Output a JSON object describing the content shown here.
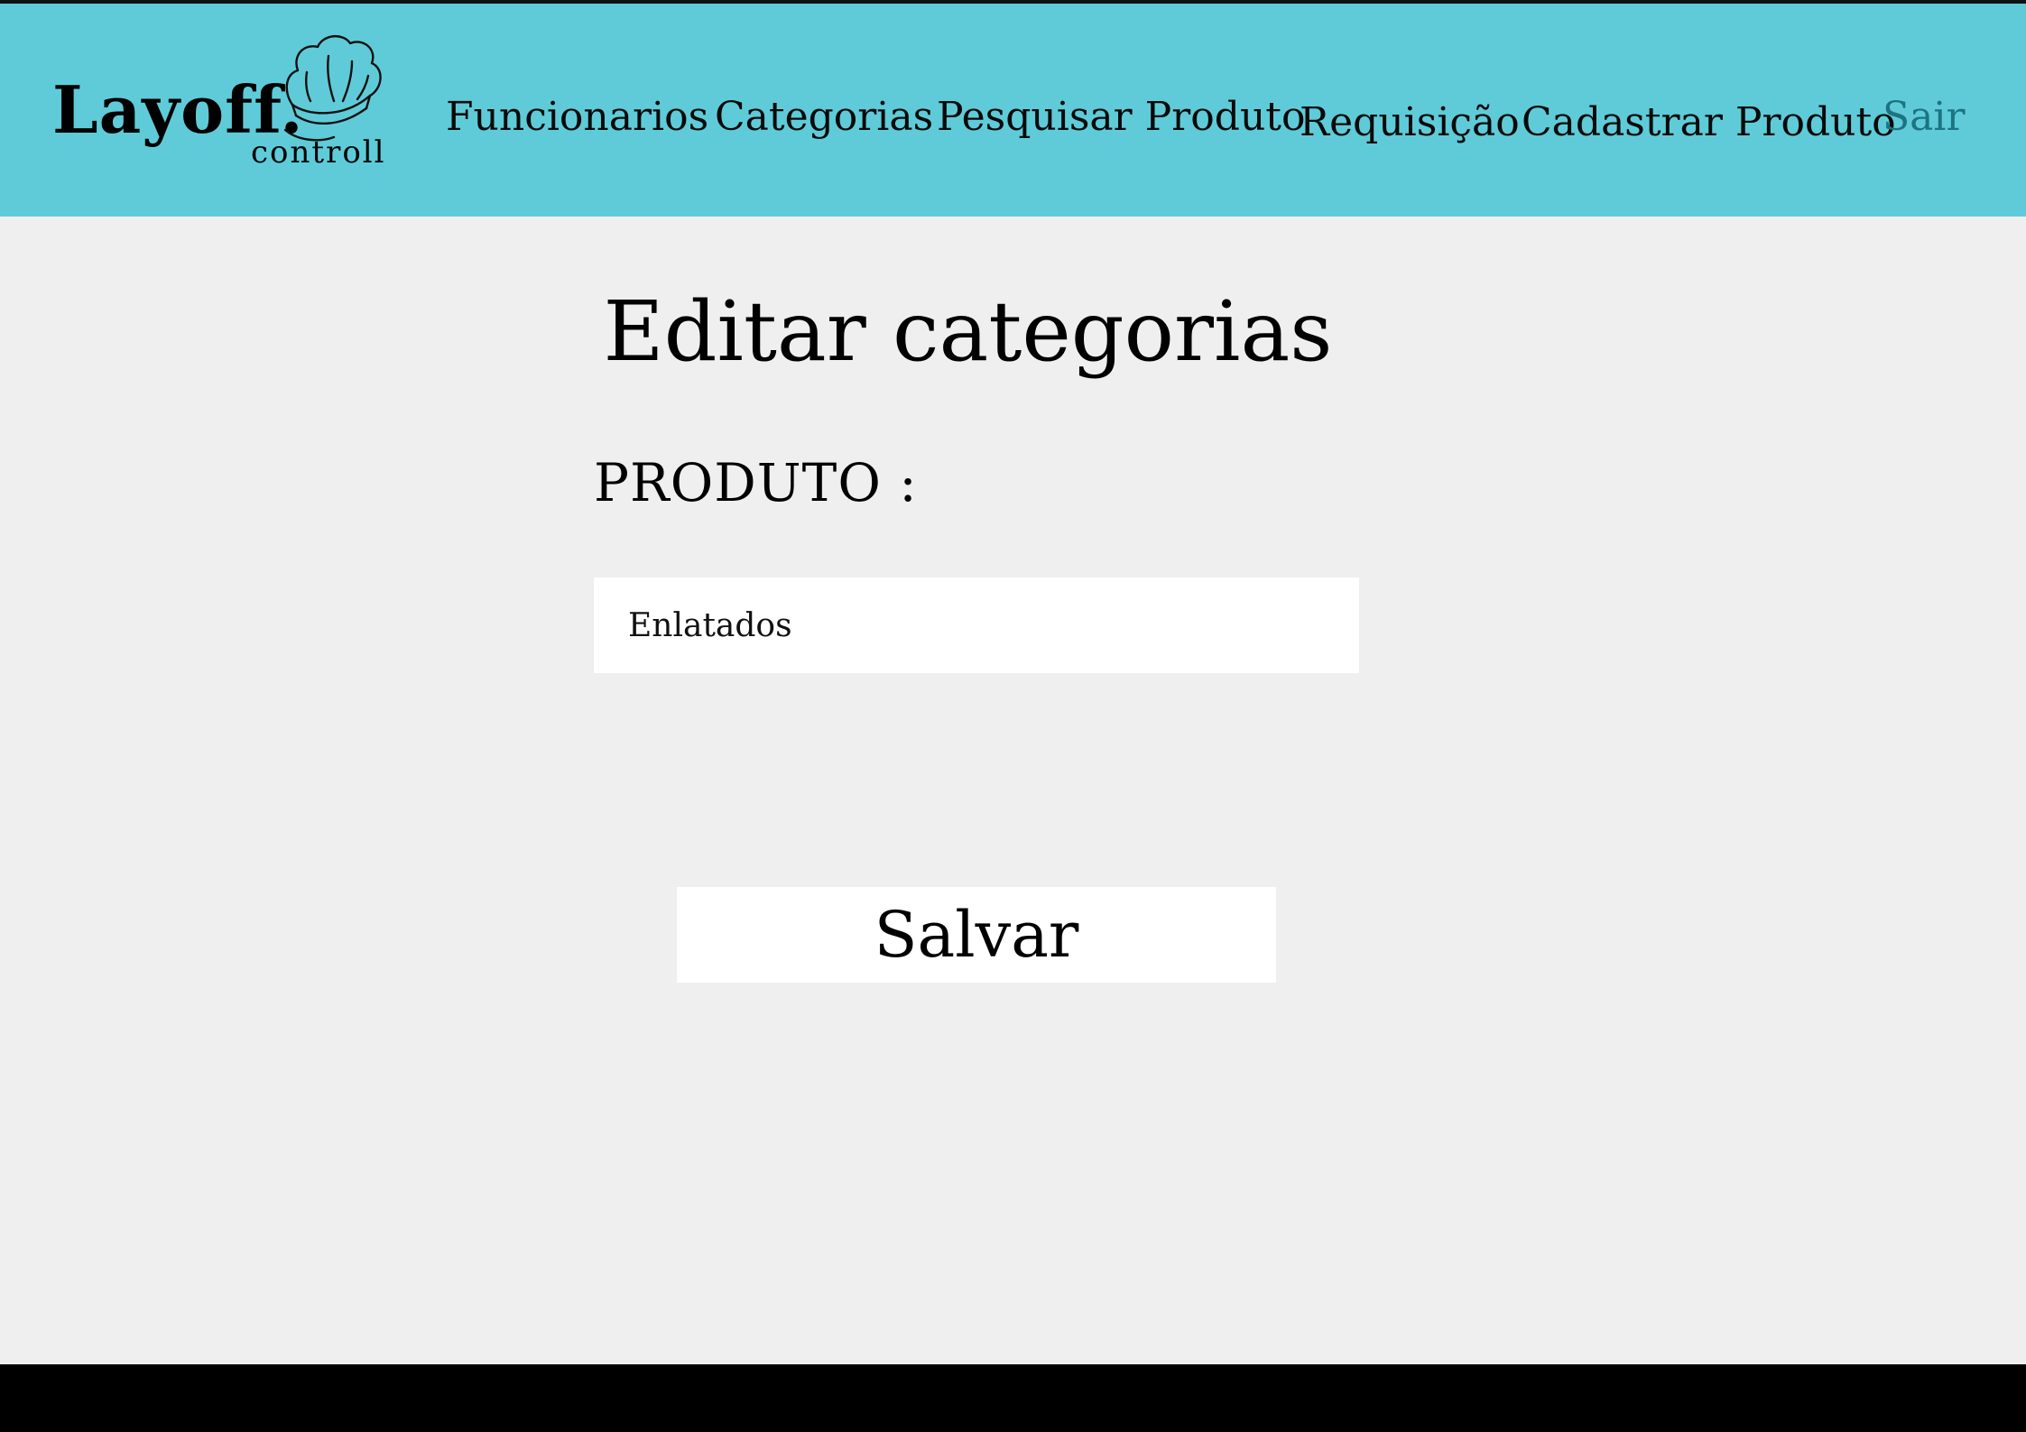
{
  "header": {
    "logo": {
      "name": "Layoff.",
      "subtitle": "controll",
      "icon": "chef-hat-icon"
    },
    "nav": {
      "funcionarios": "Funcionarios",
      "categorias": "Categorias",
      "pesquisar_produto": "Pesquisar Produto",
      "requisicao": "Requisição",
      "cadastrar_produto": "Cadastrar Produto",
      "sair": "Sair"
    }
  },
  "main": {
    "title": "Editar categorias",
    "field_label": "PRODUTO :",
    "field_value": "Enlatados",
    "save_label": "Salvar"
  },
  "colors": {
    "header_bg": "#5fcbd8",
    "page_bg": "#f0eff0",
    "sair_link": "#1c7480",
    "footer": "#000000"
  }
}
